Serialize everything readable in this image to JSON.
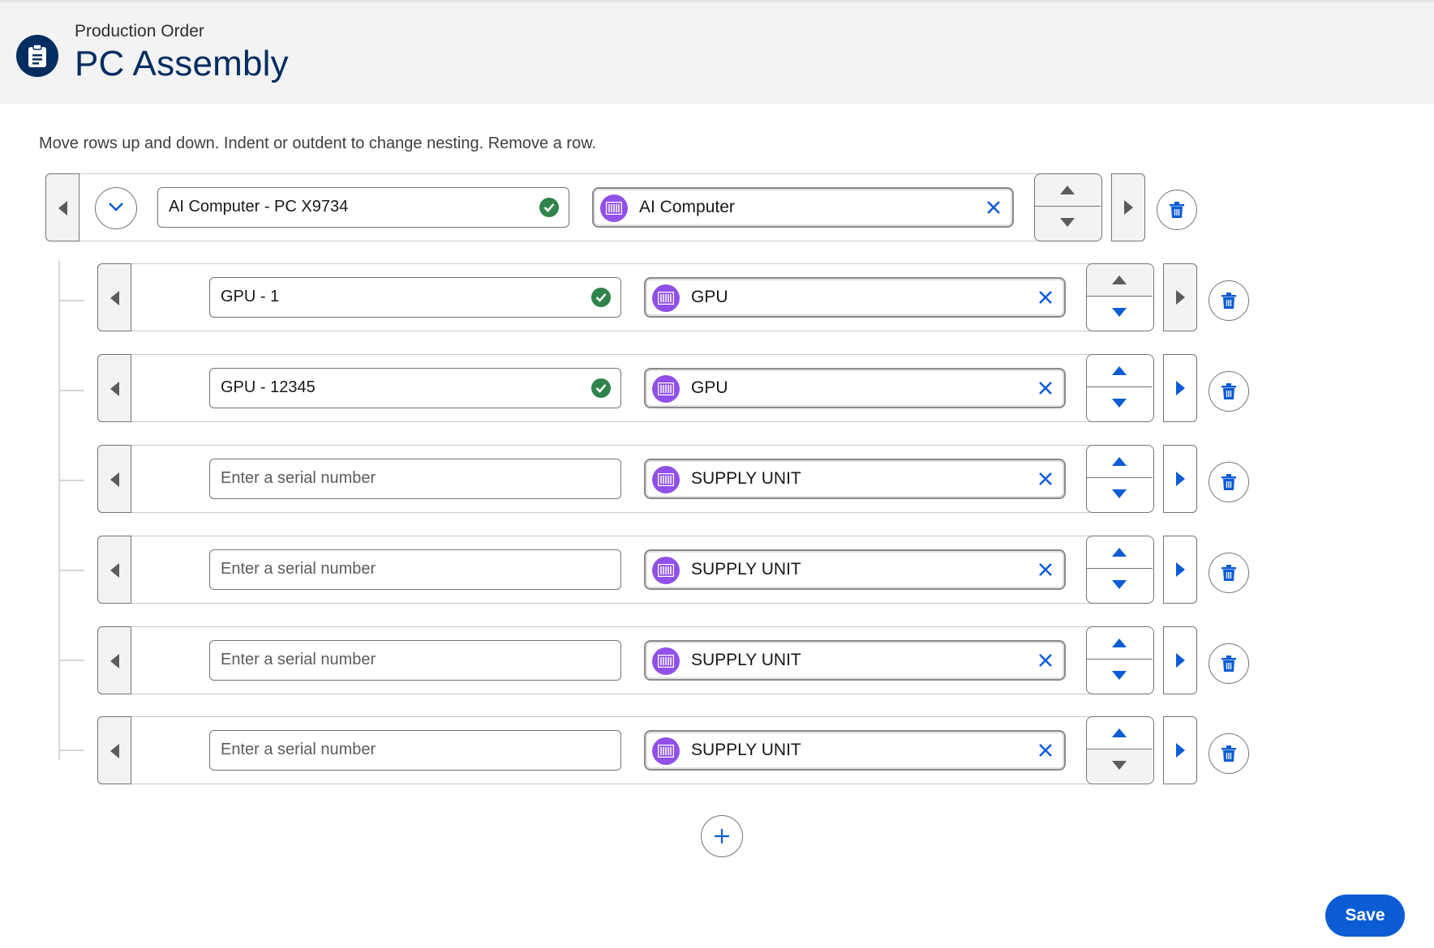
{
  "header": {
    "object_label": "Production Order",
    "title": "PC Assembly",
    "icon": "clipboard-icon"
  },
  "instructions": "Move rows up and down. Indent or outdent to change nesting. Remove a row.",
  "serial_placeholder": "Enter a serial number",
  "rows": [
    {
      "serial": "AI Computer - PC X9734",
      "serial_valid": true,
      "product": "AI Computer",
      "level": 0
    },
    {
      "serial": "GPU - 1",
      "serial_valid": true,
      "product": "GPU",
      "level": 1
    },
    {
      "serial": "GPU - 12345",
      "serial_valid": true,
      "product": "GPU",
      "level": 1
    },
    {
      "serial": "",
      "serial_valid": false,
      "product": "SUPPLY UNIT",
      "level": 1
    },
    {
      "serial": "",
      "serial_valid": false,
      "product": "SUPPLY UNIT",
      "level": 1
    },
    {
      "serial": "",
      "serial_valid": false,
      "product": "SUPPLY UNIT",
      "level": 1
    },
    {
      "serial": "",
      "serial_valid": false,
      "product": "SUPPLY UNIT",
      "level": 1
    }
  ],
  "save_label": "Save",
  "colors": {
    "accent": "#0b5cd5",
    "header_navy": "#032d60",
    "success": "#2e844a",
    "product_icon": "#9050e9",
    "disabled": "#5c5c5c"
  }
}
